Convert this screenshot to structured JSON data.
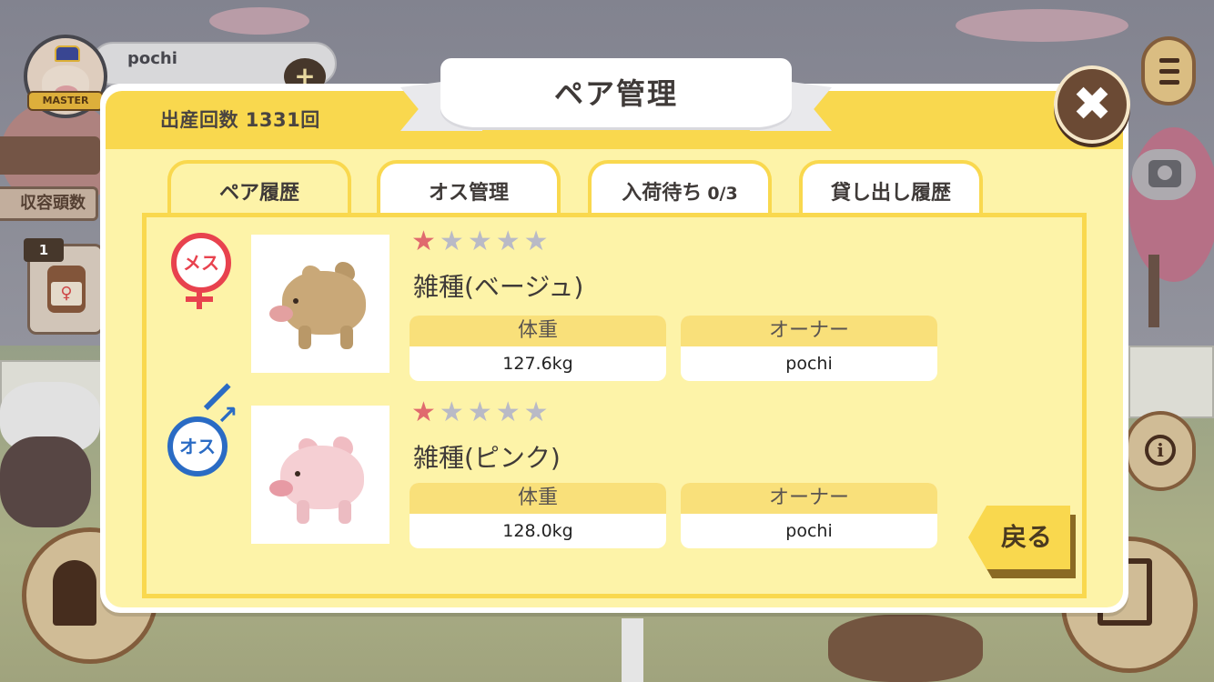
{
  "hud": {
    "player_name": "pochi",
    "badge": "MASTER",
    "plus_label": "+",
    "side_tab_label": "収容頭数",
    "item_count": "1",
    "item_symbol": "♀"
  },
  "modal": {
    "title": "ペア管理",
    "birth_count_label": "出産回数 1331回",
    "close_label": "✖",
    "tabs": [
      {
        "label": "ペア履歴",
        "active": true
      },
      {
        "label": "オス管理",
        "active": false
      },
      {
        "label": "入荷待ち",
        "count": "0/3",
        "active": false
      },
      {
        "label": "貸し出し履歴",
        "active": false
      }
    ],
    "pigs": [
      {
        "gender": "メス",
        "gender_symbol": "♀",
        "rating": 1,
        "max_rating": 5,
        "name": "雑種(ベージュ)",
        "weight_label": "体重",
        "weight": "127.6kg",
        "owner_label": "オーナー",
        "owner": "pochi",
        "color": "#c9a878"
      },
      {
        "gender": "オス",
        "gender_symbol": "♂",
        "rating": 1,
        "max_rating": 5,
        "name": "雑種(ピンク)",
        "weight_label": "体重",
        "weight": "128.0kg",
        "owner_label": "オーナー",
        "owner": "pochi",
        "color": "#f5cfd3"
      }
    ],
    "back_label": "戻る"
  },
  "colors": {
    "accent_yellow": "#f9d84e",
    "panel_yellow": "#fdf3a8",
    "female": "#e8424e",
    "male": "#2a6bc4",
    "star_on": "#e06a6e",
    "star_off": "#b9bac6"
  }
}
